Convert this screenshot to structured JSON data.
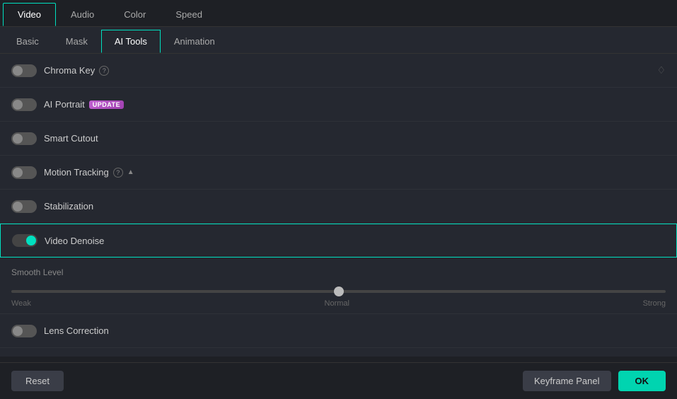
{
  "top_tabs": {
    "tabs": [
      {
        "id": "video",
        "label": "Video",
        "active": true
      },
      {
        "id": "audio",
        "label": "Audio",
        "active": false
      },
      {
        "id": "color",
        "label": "Color",
        "active": false
      },
      {
        "id": "speed",
        "label": "Speed",
        "active": false
      }
    ]
  },
  "sub_tabs": {
    "tabs": [
      {
        "id": "basic",
        "label": "Basic",
        "active": false
      },
      {
        "id": "mask",
        "label": "Mask",
        "active": false
      },
      {
        "id": "ai-tools",
        "label": "AI Tools",
        "active": true
      },
      {
        "id": "animation",
        "label": "Animation",
        "active": false
      }
    ]
  },
  "settings": [
    {
      "id": "chroma-key",
      "label": "Chroma Key",
      "has_help": true,
      "has_diamond": true,
      "has_badge": false,
      "enabled": false,
      "highlighted": false
    },
    {
      "id": "ai-portrait",
      "label": "AI Portrait",
      "has_help": false,
      "has_diamond": false,
      "has_badge": true,
      "badge_text": "UPDATE",
      "enabled": false,
      "highlighted": false
    },
    {
      "id": "smart-cutout",
      "label": "Smart Cutout",
      "has_help": false,
      "has_diamond": false,
      "has_badge": false,
      "enabled": false,
      "highlighted": false
    },
    {
      "id": "motion-tracking",
      "label": "Motion Tracking",
      "has_help": true,
      "has_chevron": true,
      "has_diamond": false,
      "has_badge": false,
      "enabled": false,
      "highlighted": false
    },
    {
      "id": "stabilization",
      "label": "Stabilization",
      "has_help": false,
      "has_diamond": false,
      "has_badge": false,
      "enabled": false,
      "highlighted": false
    },
    {
      "id": "video-denoise",
      "label": "Video Denoise",
      "has_help": false,
      "has_diamond": false,
      "has_badge": false,
      "enabled": true,
      "highlighted": true
    }
  ],
  "smooth_level": {
    "label": "Smooth Level",
    "value": 50,
    "min": 0,
    "max": 100,
    "labels": [
      "Weak",
      "Normal",
      "Strong"
    ]
  },
  "lens_correction": {
    "id": "lens-correction",
    "label": "Lens Correction",
    "enabled": false
  },
  "bottom_bar": {
    "reset_label": "Reset",
    "keyframe_label": "Keyframe Panel",
    "ok_label": "OK"
  }
}
